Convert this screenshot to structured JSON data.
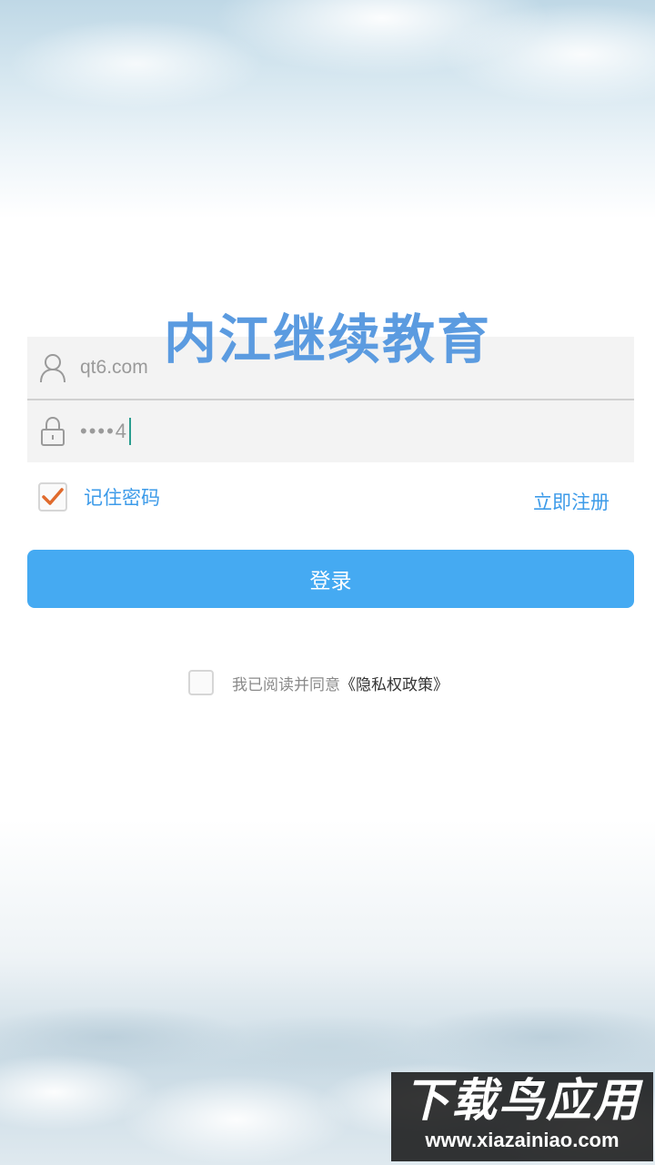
{
  "app_title": "内江继续教育",
  "form": {
    "username_value": "qt6.com",
    "password_value": "••••4",
    "remember_label": "记住密码",
    "remember_checked": true,
    "register_label": "立即注册",
    "login_label": "登录"
  },
  "agreement": {
    "text": "我已阅读并同意",
    "policy_link": "《隐私权政策》",
    "checked": false
  },
  "watermark": {
    "title": "下载鸟应用",
    "url": "www.xiazainiao.com"
  },
  "colors": {
    "accent": "#45aaf2",
    "title": "#5b9be0",
    "link": "#3d9be9",
    "check": "#e06a2c"
  }
}
